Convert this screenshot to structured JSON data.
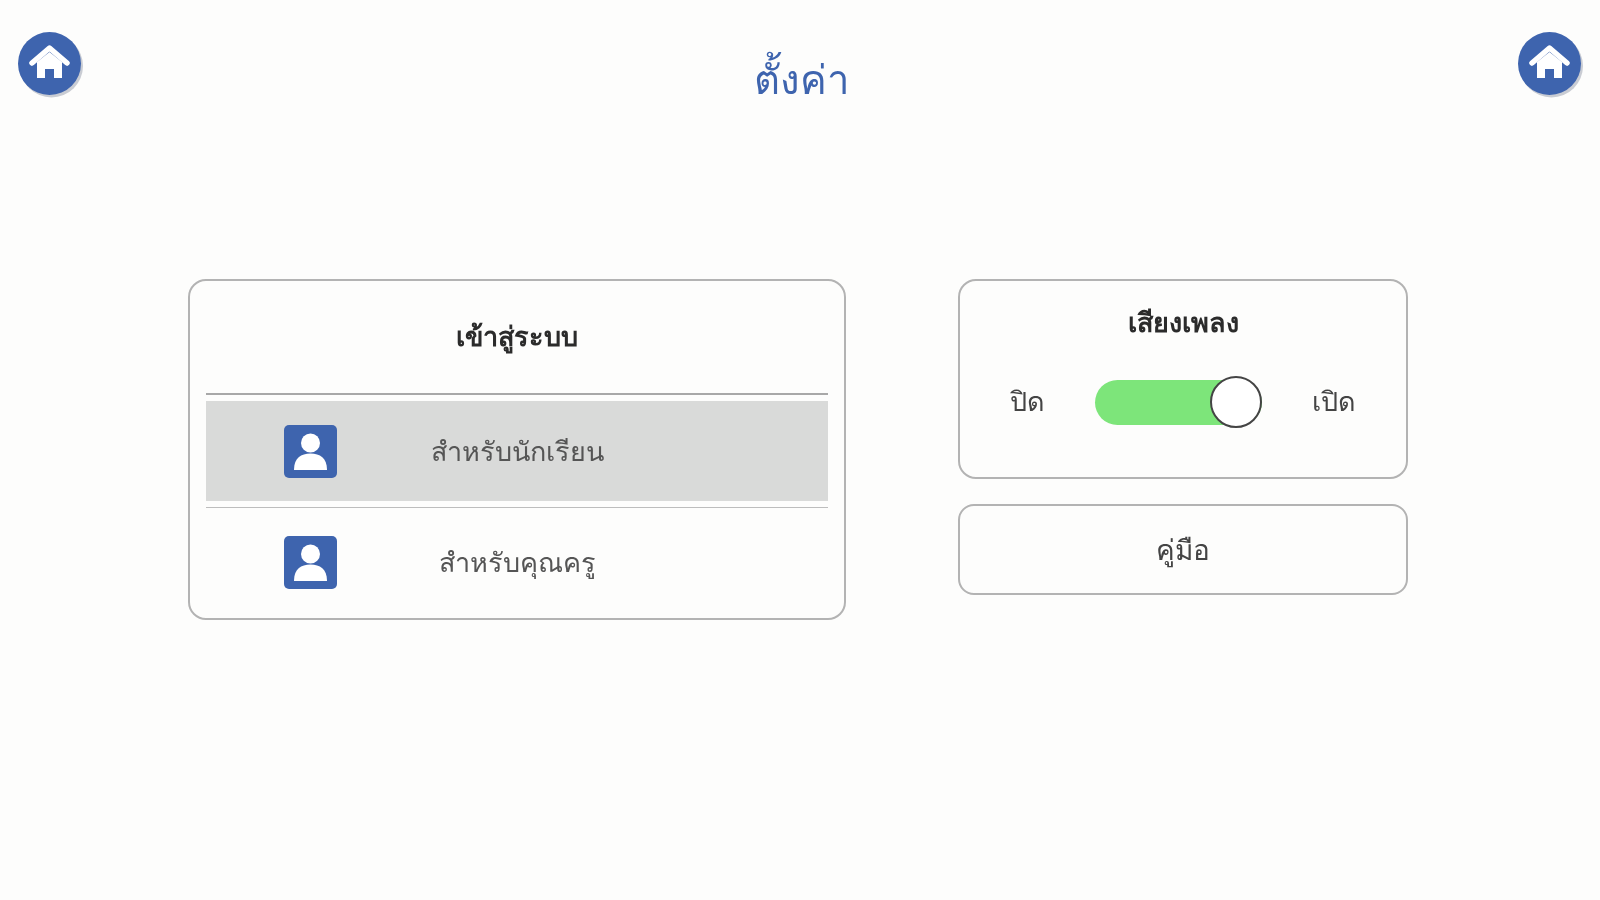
{
  "header": {
    "title": "ตั้งค่า"
  },
  "login_panel": {
    "title": "เข้าสู่ระบบ",
    "options": [
      {
        "label": "สำหรับนักเรียน",
        "selected": true
      },
      {
        "label": "สำหรับคุณครู",
        "selected": false
      }
    ]
  },
  "music_panel": {
    "title": "เสียงเพลง",
    "off_label": "ปิด",
    "on_label": "เปิด",
    "on": true
  },
  "manual_button": {
    "label": "คู่มือ"
  }
}
